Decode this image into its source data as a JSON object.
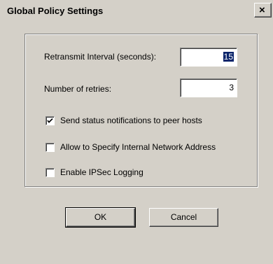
{
  "window": {
    "title": "Global Policy Settings",
    "close_glyph": "×"
  },
  "fields": {
    "retransmit_label": "Retransmit Interval (seconds):",
    "retransmit_value": "15",
    "retries_label": "Number of retries:",
    "retries_value": "3"
  },
  "options": [
    {
      "label": "Send status notifications to peer hosts",
      "checked": true
    },
    {
      "label": "Allow to Specify Internal Network Address",
      "checked": false
    },
    {
      "label": "Enable IPSec Logging",
      "checked": false
    }
  ],
  "buttons": {
    "ok": "OK",
    "cancel": "Cancel"
  },
  "colors": {
    "dialog_bg": "#d4d0c8",
    "selection": "#0a246a"
  }
}
